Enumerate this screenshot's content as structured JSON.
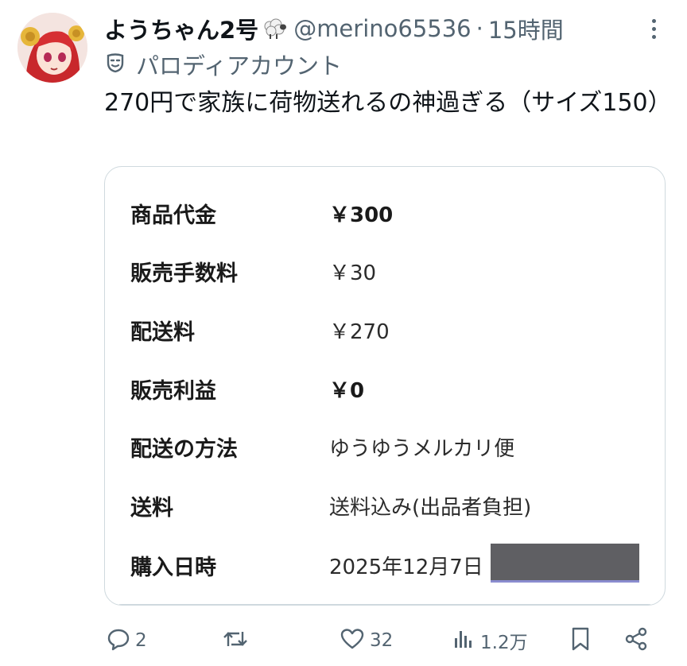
{
  "post": {
    "display_name": "ようちゃん2号",
    "handle": "@merino65536",
    "separator": "·",
    "time": "15時間",
    "parody_label": "パロディアカウント",
    "text": "270円で家族に荷物送れるの神過ぎる（サイズ150）"
  },
  "receipt": {
    "rows": [
      {
        "label": "商品代金",
        "value": "￥300",
        "bold": true
      },
      {
        "label": "販売手数料",
        "value": "￥30",
        "bold": false
      },
      {
        "label": "配送料",
        "value": "￥270",
        "bold": false
      },
      {
        "label": "販売利益",
        "value": "￥0",
        "bold": true
      },
      {
        "label": "配送の方法",
        "value": "ゆうゆうメルカリ便",
        "bold": false
      },
      {
        "label": "送料",
        "value": "送料込み(出品者負担)",
        "bold": false
      },
      {
        "label": "購入日時",
        "value": "2025年12月7日",
        "bold": false
      }
    ]
  },
  "actions": {
    "reply": {
      "icon": "reply-icon",
      "count": "2"
    },
    "repost": {
      "icon": "repost-icon",
      "count": ""
    },
    "like": {
      "icon": "heart-icon",
      "count": "32"
    },
    "views": {
      "icon": "views-icon",
      "count": "1.2万"
    },
    "bookmark": {
      "icon": "bookmark-icon"
    },
    "share": {
      "icon": "share-icon"
    }
  },
  "colors": {
    "text_primary": "#0f1419",
    "text_secondary": "#536471",
    "border": "#cfd9de",
    "redaction": "#5f5f63"
  }
}
